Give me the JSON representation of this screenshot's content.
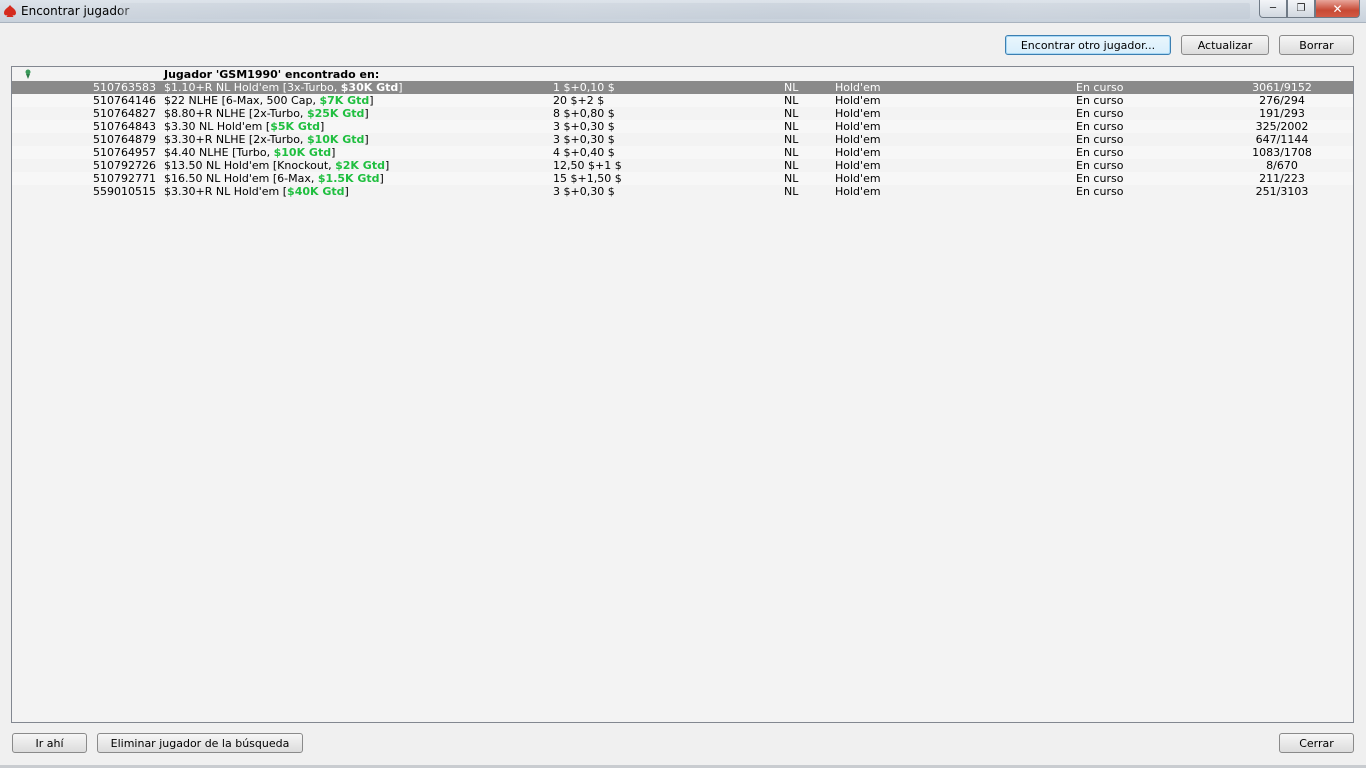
{
  "window": {
    "title": "Encontrar jugador"
  },
  "toolbar": {
    "find_other": "Encontrar otro jugador...",
    "refresh": "Actualizar",
    "clear": "Borrar"
  },
  "list": {
    "header": "Jugador 'GSM1990' encontrado en:",
    "rows": [
      {
        "id": "510763583",
        "name": "$1.10+R NL Hold'em [3x-Turbo, ",
        "gtd": "$30K Gtd",
        "close": "]",
        "buyin": "1 $+0,10 $",
        "limit": "NL",
        "game": "Hold'em",
        "status": "En curso",
        "players": "3061/9152"
      },
      {
        "id": "510764146",
        "name": "$22 NLHE [6-Max, 500 Cap, ",
        "gtd": "$7K Gtd",
        "close": "]",
        "buyin": "20 $+2 $",
        "limit": "NL",
        "game": "Hold'em",
        "status": "En curso",
        "players": "276/294"
      },
      {
        "id": "510764827",
        "name": "$8.80+R NLHE [2x-Turbo, ",
        "gtd": "$25K Gtd",
        "close": "]",
        "buyin": "8 $+0,80 $",
        "limit": "NL",
        "game": "Hold'em",
        "status": "En curso",
        "players": "191/293"
      },
      {
        "id": "510764843",
        "name": "$3.30 NL Hold'em [",
        "gtd": "$5K Gtd",
        "close": "]",
        "buyin": "3 $+0,30 $",
        "limit": "NL",
        "game": "Hold'em",
        "status": "En curso",
        "players": "325/2002"
      },
      {
        "id": "510764879",
        "name": "$3.30+R NLHE [2x-Turbo, ",
        "gtd": "$10K Gtd",
        "close": "]",
        "buyin": "3 $+0,30 $",
        "limit": "NL",
        "game": "Hold'em",
        "status": "En curso",
        "players": "647/1144"
      },
      {
        "id": "510764957",
        "name": "$4.40 NLHE [Turbo, ",
        "gtd": "$10K Gtd",
        "close": "]",
        "buyin": "4 $+0,40 $",
        "limit": "NL",
        "game": "Hold'em",
        "status": "En curso",
        "players": "1083/1708"
      },
      {
        "id": "510792726",
        "name": "$13.50 NL Hold'em [Knockout, ",
        "gtd": "$2K Gtd",
        "close": "]",
        "buyin": "12,50 $+1 $",
        "limit": "NL",
        "game": "Hold'em",
        "status": "En curso",
        "players": "8/670"
      },
      {
        "id": "510792771",
        "name": "$16.50 NL Hold'em [6-Max, ",
        "gtd": "$1.5K Gtd",
        "close": "]",
        "buyin": "15 $+1,50 $",
        "limit": "NL",
        "game": "Hold'em",
        "status": "En curso",
        "players": "211/223"
      },
      {
        "id": "559010515",
        "name": "$3.30+R NL Hold'em [",
        "gtd": "$40K Gtd",
        "close": "]",
        "buyin": "3 $+0,30 $",
        "limit": "NL",
        "game": "Hold'em",
        "status": "En curso",
        "players": "251/3103"
      }
    ]
  },
  "footer": {
    "go_there": "Ir ahí",
    "remove_player": "Eliminar jugador de la búsqueda",
    "close": "Cerrar"
  },
  "colors": {
    "gtd": "#1fbf3f",
    "selected_row": "#8a8a8a"
  }
}
